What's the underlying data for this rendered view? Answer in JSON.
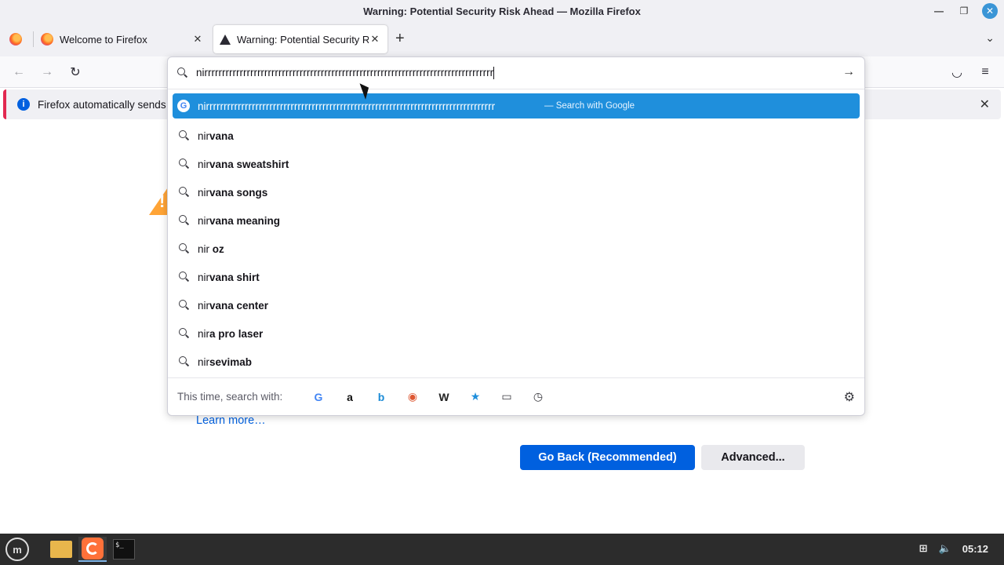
{
  "window": {
    "title": "Warning: Potential Security Risk Ahead — Mozilla Firefox"
  },
  "tabs": [
    {
      "label": "Welcome to Firefox"
    },
    {
      "label": "Warning: Potential Security Risk Ahead"
    }
  ],
  "notification": {
    "text": "Firefox automatically sends"
  },
  "urlbar": {
    "value": "nirrrrrrrrrrrrrrrrrrrrrrrrrrrrrrrrrrrrrrrrrrrrrrrrrrrrrrrrrrrrrrrrrrrrrrrrrrrrrrrrrr",
    "heuristic": {
      "text": "nirrrrrrrrrrrrrrrrrrrrrrrrrrrrrrrrrrrrrrrrrrrrrrrrrrrrrrrrrrrrrrrrrrrrrrrrrrrrrrrrrr",
      "action": "— Search with Google"
    },
    "suggestions": [
      {
        "typed": "nir",
        "completion": "vana"
      },
      {
        "typed": "nir",
        "completion": "vana sweatshirt"
      },
      {
        "typed": "nir",
        "completion": "vana songs"
      },
      {
        "typed": "nir",
        "completion": "vana meaning"
      },
      {
        "typed": "nir",
        "completion": " oz"
      },
      {
        "typed": "nir",
        "completion": "vana shirt"
      },
      {
        "typed": "nir",
        "completion": "vana center"
      },
      {
        "typed": "nir",
        "completion": "a pro laser"
      },
      {
        "typed": "nir",
        "completion": "sevimab"
      }
    ],
    "oneoff_label": "This time, search with:",
    "engines": [
      {
        "icon": "google-icon",
        "glyph": "G",
        "color": "#4285f4"
      },
      {
        "icon": "amazon-icon",
        "glyph": "a",
        "color": "#111111"
      },
      {
        "icon": "bing-icon",
        "glyph": "b",
        "color": "#1b8bd6"
      },
      {
        "icon": "duckduckgo-icon",
        "glyph": "◉",
        "color": "#de5833"
      },
      {
        "icon": "wikipedia-icon",
        "glyph": "W",
        "color": "#222222"
      },
      {
        "icon": "bookmarks-icon",
        "glyph": "★",
        "color": "#1f8fdc"
      },
      {
        "icon": "tabs-icon",
        "glyph": "▭",
        "color": "#3a3a40"
      },
      {
        "icon": "history-icon",
        "glyph": "◷",
        "color": "#3a3a40"
      }
    ]
  },
  "page": {
    "learn_more": "Learn more…",
    "go_back": "Go Back (Recommended)",
    "advanced": "Advanced..."
  },
  "taskbar": {
    "clock": "05:12"
  }
}
